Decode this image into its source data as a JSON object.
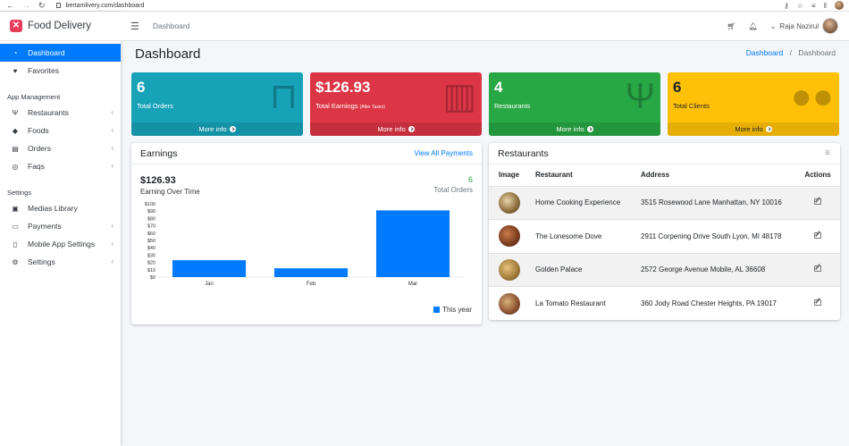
{
  "browser": {
    "url": "bertamlivery.com/dashboard"
  },
  "brand": {
    "logo": "✕",
    "name": "Food Delivery"
  },
  "sidebar": {
    "items_top": [
      {
        "label": "Dashboard",
        "icon": "dashboard-icon",
        "glyph": "◔",
        "active": true
      },
      {
        "label": "Favorites",
        "icon": "heart-icon",
        "glyph": "♥",
        "active": false
      }
    ],
    "header_app": "App Management",
    "items_app": [
      {
        "label": "Restaurants",
        "icon": "utensils-icon",
        "glyph": "Ψ"
      },
      {
        "label": "Foods",
        "icon": "food-icon",
        "glyph": "◆"
      },
      {
        "label": "Orders",
        "icon": "inbox-icon",
        "glyph": "▤"
      },
      {
        "label": "Faqs",
        "icon": "support-icon",
        "glyph": "◎"
      }
    ],
    "header_settings": "Settings",
    "items_settings": [
      {
        "label": "Medias Library",
        "icon": "image-icon",
        "glyph": "▣"
      },
      {
        "label": "Payments",
        "icon": "credit-card-icon",
        "glyph": "▭"
      },
      {
        "label": "Mobile App Settings",
        "icon": "mobile-icon",
        "glyph": "▯"
      },
      {
        "label": "Settings",
        "icon": "gears-icon",
        "glyph": "⚙"
      }
    ]
  },
  "topbar": {
    "title": "Dashboard",
    "user": "Raja Nazirul"
  },
  "page": {
    "title": "Dashboard",
    "breadcrumb_link": "Dashboard",
    "breadcrumb_current": "Dashboard"
  },
  "boxes": [
    {
      "value": "6",
      "label": "Total Orders",
      "label_small": "",
      "footer": "More info",
      "icon": "shopping-bag-icon",
      "glyph": "⊓"
    },
    {
      "value": "$126.93",
      "label": "Total Earnings",
      "label_small": "(After Taxes)",
      "footer": "More info",
      "icon": "money-bill-icon",
      "glyph": "▥"
    },
    {
      "value": "4",
      "label": "Restaurants",
      "label_small": "",
      "footer": "More info",
      "icon": "utensils-icon",
      "glyph": "Ψ"
    },
    {
      "value": "6",
      "label": "Total Clients",
      "label_small": "",
      "footer": "More info",
      "icon": "users-icon",
      "glyph": "●●"
    }
  ],
  "earnings": {
    "title": "Earnings",
    "view_all": "View All Payments",
    "total_value": "$126.93",
    "total_label": "Earning Over Time",
    "orders_value": "6",
    "orders_label": "Total Orders",
    "legend": "This year"
  },
  "chart_data": {
    "type": "bar",
    "categories": [
      "Jan",
      "Feb",
      "Mar"
    ],
    "series": [
      {
        "name": "This year",
        "values": [
          23,
          12,
          91
        ],
        "color": "#007bff"
      }
    ],
    "yticks": [
      "$0",
      "$10",
      "$20",
      "$30",
      "$40",
      "$50",
      "$60",
      "$70",
      "$80",
      "$90",
      "$100"
    ],
    "ylim": [
      0,
      100
    ]
  },
  "restaurants": {
    "title": "Restaurants",
    "columns": [
      "Image",
      "Restaurant",
      "Address",
      "Actions"
    ],
    "rows": [
      {
        "name": "Home Cooking Experience",
        "address": "3515 Rosewood Lane Manhattan, NY 10016"
      },
      {
        "name": "The Lonesome Dove",
        "address": "2911 Corpening Drive South Lyon, MI 48178"
      },
      {
        "name": "Golden Palace",
        "address": "2572 George Avenue Mobile, AL 36608"
      },
      {
        "name": "La Tomato Restaurant",
        "address": "360 Jody Road Chester Heights, PA 19017"
      }
    ]
  }
}
